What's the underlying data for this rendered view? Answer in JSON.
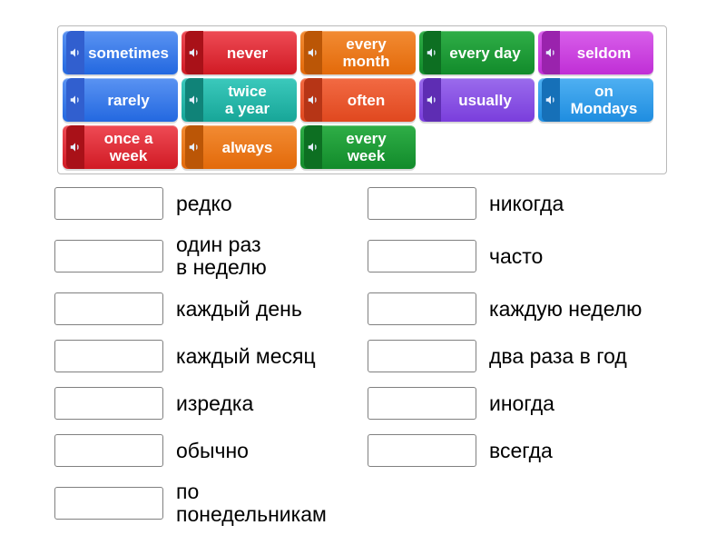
{
  "tiles": [
    {
      "label": "sometimes",
      "bg": "#2368e0",
      "bgLight": "#5a93f2",
      "spk": "#315fcf"
    },
    {
      "label": "never",
      "bg": "#d11b24",
      "bgLight": "#ee4b55",
      "spk": "#a91118"
    },
    {
      "label": "every\nmonth",
      "bg": "#e36a0a",
      "bgLight": "#f28b33",
      "spk": "#bb5606"
    },
    {
      "label": "every day",
      "bg": "#128b2b",
      "bgLight": "#2fae47",
      "spk": "#0d6f22"
    },
    {
      "label": "seldom",
      "bg": "#c02fd6",
      "bgLight": "#d85fea",
      "spk": "#9a23ad"
    },
    {
      "label": "rarely",
      "bg": "#2368e0",
      "bgLight": "#5a93f2",
      "spk": "#315fcf"
    },
    {
      "label": "twice\na year",
      "bg": "#17a698",
      "bgLight": "#3bc9bc",
      "spk": "#108378"
    },
    {
      "label": "often",
      "bg": "#e0481f",
      "bgLight": "#f26a43",
      "spk": "#b63516"
    },
    {
      "label": "usually",
      "bg": "#7a3edc",
      "bgLight": "#9a6bec",
      "spk": "#5e2db3"
    },
    {
      "label": "on\nMondays",
      "bg": "#1f8de0",
      "bgLight": "#4fb0f2",
      "spk": "#1670b8"
    },
    {
      "label": "once a\nweek",
      "bg": "#d11b24",
      "bgLight": "#ee4b55",
      "spk": "#a91118"
    },
    {
      "label": "always",
      "bg": "#e36a0a",
      "bgLight": "#f28b33",
      "spk": "#bb5606"
    },
    {
      "label": "every\nweek",
      "bg": "#128b2b",
      "bgLight": "#2fae47",
      "spk": "#0d6f22"
    }
  ],
  "dropRows": [
    {
      "label": "редко"
    },
    {
      "label": "никогда"
    },
    {
      "label": "один раз\nв неделю"
    },
    {
      "label": "часто"
    },
    {
      "label": "каждый день"
    },
    {
      "label": "каждую неделю"
    },
    {
      "label": "каждый месяц"
    },
    {
      "label": "два раза в год"
    },
    {
      "label": "изредка"
    },
    {
      "label": "иногда"
    },
    {
      "label": "обычно"
    },
    {
      "label": "всегда"
    },
    {
      "label": "по\nпонедельникам"
    }
  ]
}
